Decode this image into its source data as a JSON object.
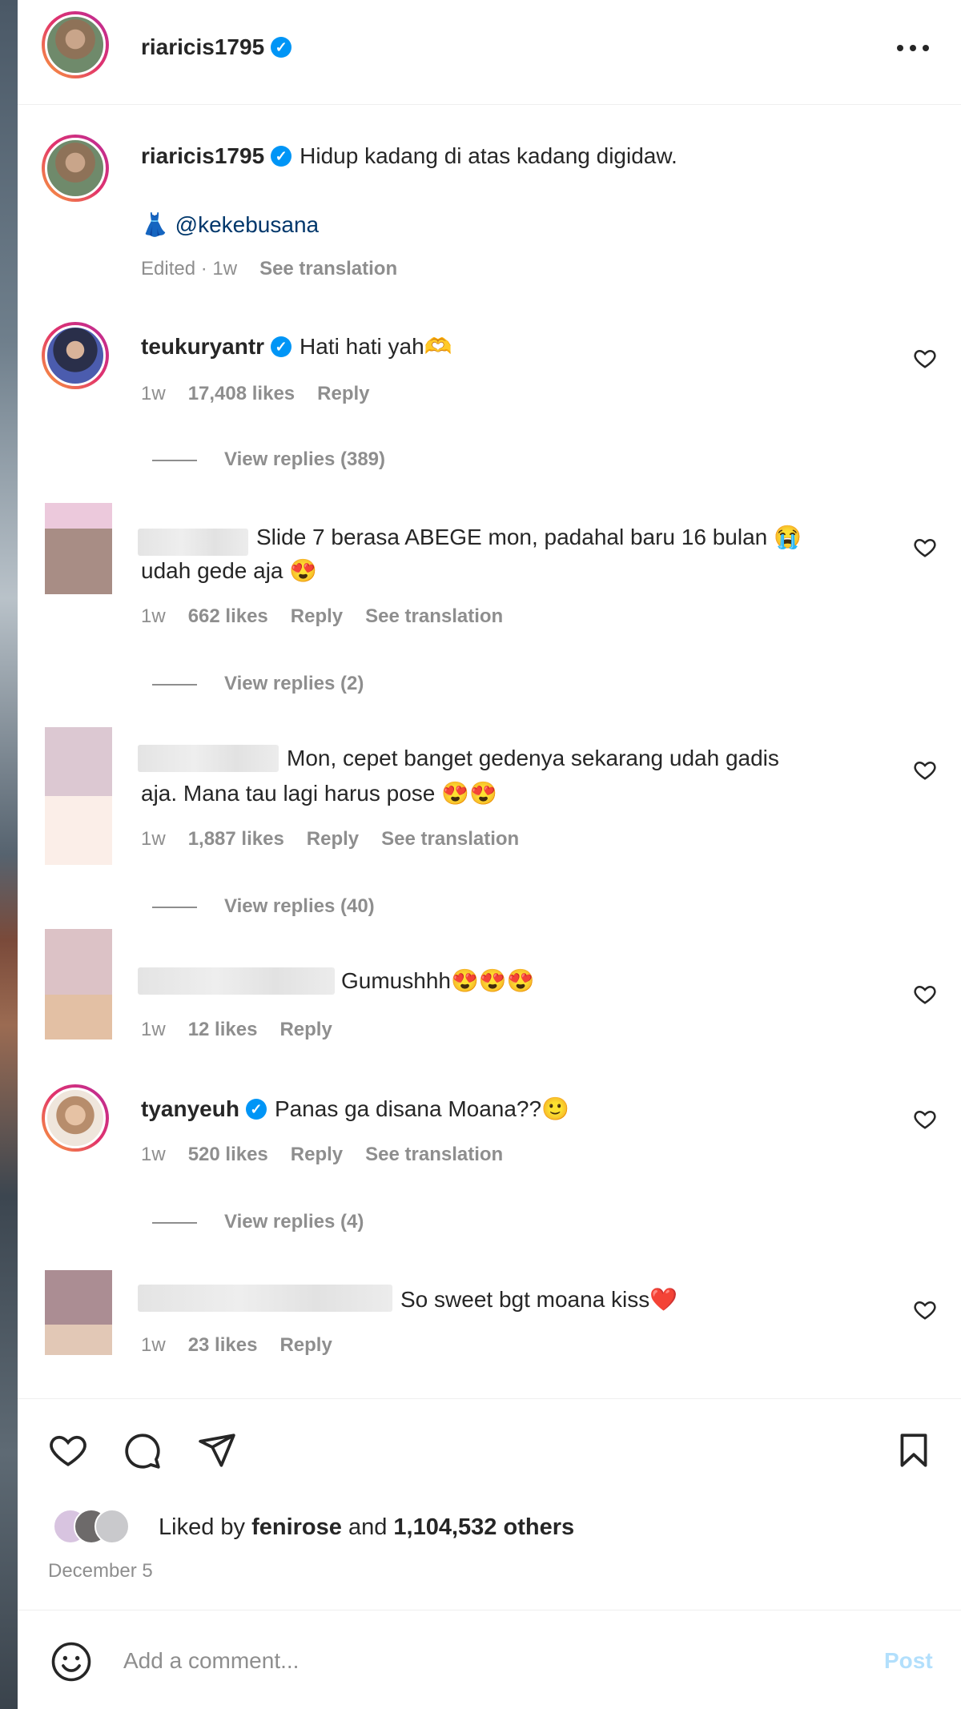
{
  "header": {
    "username": "riaricis1795",
    "more_icon": "more-horizontal-icon"
  },
  "caption": {
    "username": "riaricis1795",
    "text": "Hidup kadang di atas kadang digidaw.",
    "dress_emoji": "👗",
    "mention": "@kekebusana",
    "edited": "Edited · 1w",
    "see_translation": "See translation"
  },
  "comments": [
    {
      "username": "teukuryantr",
      "text": "Hati hati yah🫶",
      "time": "1w",
      "likes": "17,408 likes",
      "reply": "Reply",
      "view_replies": "View replies (389)"
    },
    {
      "username": "",
      "text_line1": "Slide 7 berasa ABEGE mon, padahal baru 16 bulan 😭",
      "text_line2": "udah gede aja 😍",
      "time": "1w",
      "likes": "662 likes",
      "reply": "Reply",
      "see_translation": "See translation",
      "view_replies": "View replies (2)"
    },
    {
      "username": "",
      "text_line1": "Mon, cepet banget gedenya sekarang udah gadis",
      "text_line2": "aja. Mana tau lagi harus pose 😍😍",
      "time": "1w",
      "likes": "1,887 likes",
      "reply": "Reply",
      "see_translation": "See translation",
      "view_replies": "View replies (40)"
    },
    {
      "username": "",
      "text": "Gumushhh😍😍😍",
      "time": "1w",
      "likes": "12 likes",
      "reply": "Reply"
    },
    {
      "username": "tyanyeuh",
      "text": "Panas ga disana Moana??🙂",
      "time": "1w",
      "likes": "520 likes",
      "reply": "Reply",
      "see_translation": "See translation",
      "view_replies": "View replies (4)"
    },
    {
      "username": "",
      "text": "So sweet bgt moana kiss❤️",
      "time": "1w",
      "likes": "23 likes",
      "reply": "Reply"
    }
  ],
  "actions": {
    "like_icon": "heart-icon",
    "comment_icon": "comment-icon",
    "share_icon": "send-icon",
    "save_icon": "bookmark-icon"
  },
  "likes_summary": {
    "prefix": "Liked by",
    "user": "fenirose",
    "middle": "and",
    "count": "1,104,532 others"
  },
  "date": "December 5",
  "comment_box": {
    "placeholder": "Add a comment...",
    "post": "Post",
    "emoji_icon": "smiley-icon"
  },
  "colors": {
    "verified": "#0095f6",
    "link": "#00376b",
    "meta": "#8e8e8e",
    "post_disabled": "#b2dffc"
  }
}
